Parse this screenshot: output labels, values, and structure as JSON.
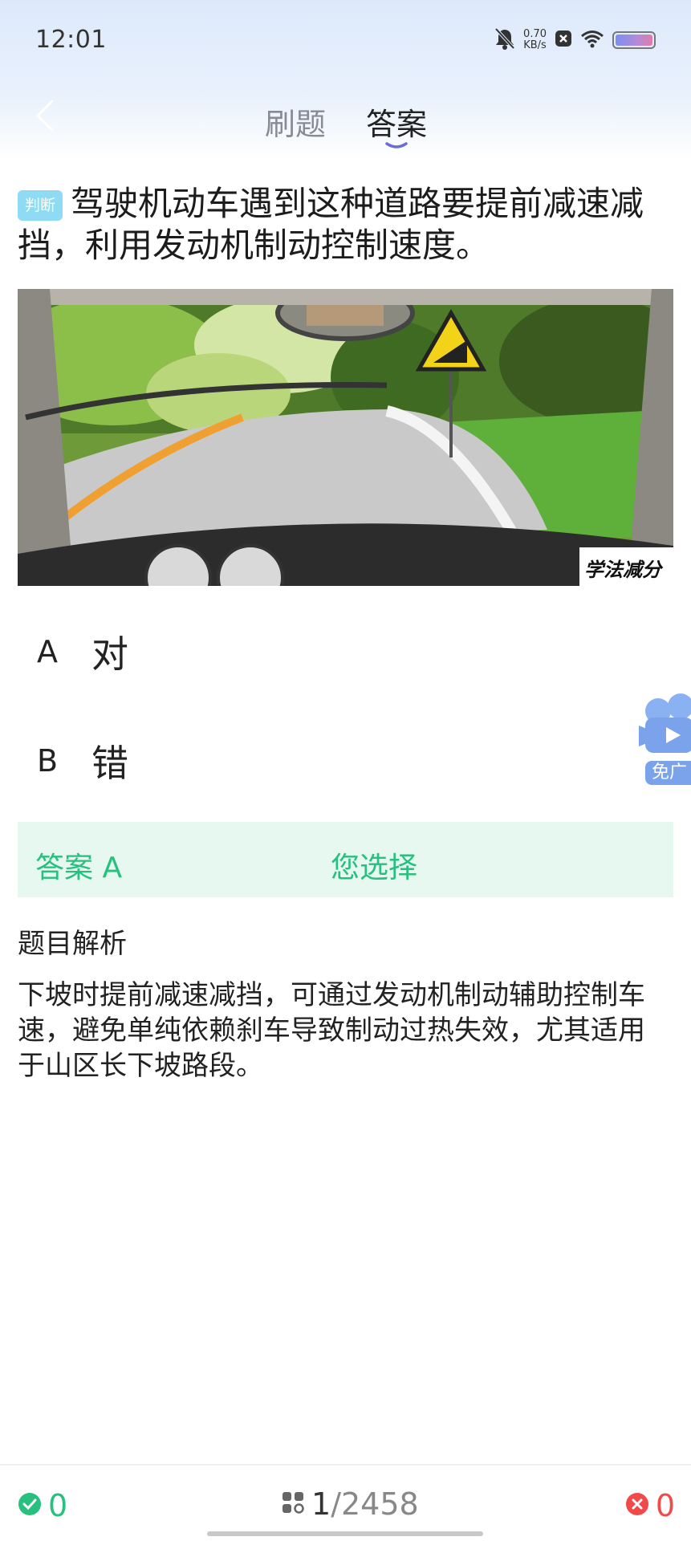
{
  "status_bar": {
    "time": "12:01",
    "net_speed_value": "0.70",
    "net_speed_unit": "KB/s"
  },
  "header": {
    "tabs": [
      {
        "label": "刷题",
        "active": false
      },
      {
        "label": "答案",
        "active": true
      }
    ]
  },
  "question": {
    "tag": "判断",
    "text": "驾驶机动车遇到这种道路要提前减速减挡，利用发动机制动控制速度。",
    "image_watermark": "学法减分"
  },
  "options": [
    {
      "letter": "A",
      "text": "对"
    },
    {
      "letter": "B",
      "text": "错"
    }
  ],
  "floating_ad": {
    "label": "免广"
  },
  "answer": {
    "label": "答案 A",
    "your_choice": "您选择"
  },
  "analysis": {
    "title": "题目解析",
    "text": "下坡时提前减速减挡，可通过发动机制动辅助控制车速，避免单纯依赖刹车导致制动过热失效，尤其适用于山区长下坡路段。"
  },
  "bottom_bar": {
    "correct_count": "0",
    "current": "1",
    "total": "/2458",
    "wrong_count": "0"
  },
  "colors": {
    "accent_green": "#27c07e",
    "error_red": "#f04a4a",
    "tag_blue": "#8fdbf3",
    "tab_underline": "#6b6bd6"
  }
}
